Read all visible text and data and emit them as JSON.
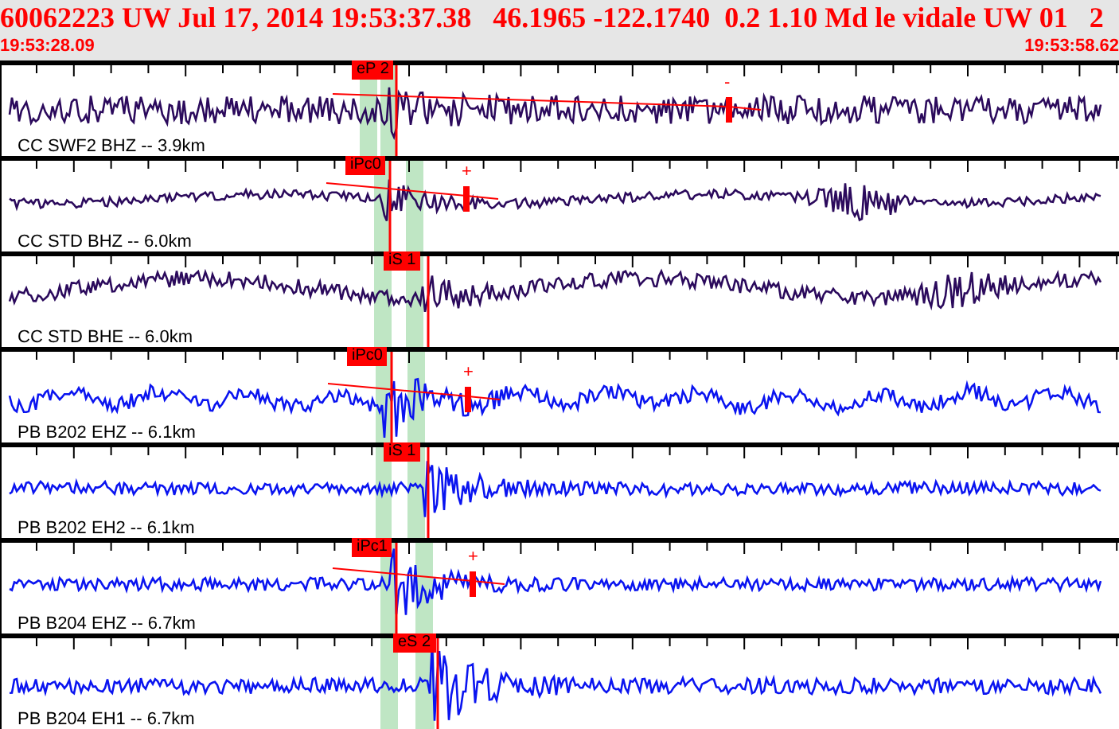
{
  "header": {
    "title": "60062223 UW Jul 17, 2014 19:53:37.38   46.1965 -122.1740  0.2 1.10 Md le vidale UW 01   2",
    "start_time": "19:53:28.09",
    "end_time": "19:53:58.62"
  },
  "traces": [
    {
      "label": "CC SWF2 BHZ -- 3.9km",
      "color": "#2b0a5c",
      "pick": "eP 2",
      "amp_mark": "-"
    },
    {
      "label": "CC STD BHZ -- 6.0km",
      "color": "#2b0a5c",
      "pick": "iPc0",
      "amp_mark": "+"
    },
    {
      "label": "CC STD BHE -- 6.0km",
      "color": "#2b0a5c",
      "pick": "iS 1"
    },
    {
      "label": "PB B202 EHZ -- 6.1km",
      "color": "#0a14f0",
      "pick": "iPc0",
      "amp_mark": "+"
    },
    {
      "label": "PB B202 EH2 -- 6.1km",
      "color": "#0a14f0",
      "pick": "iS 1"
    },
    {
      "label": "PB B204 EHZ -- 6.7km",
      "color": "#0a14f0",
      "pick": "iPc1",
      "amp_mark": "+"
    },
    {
      "label": "PB B204 EH1 -- 6.7km",
      "color": "#0a14f0",
      "pick": "eS 2"
    }
  ]
}
